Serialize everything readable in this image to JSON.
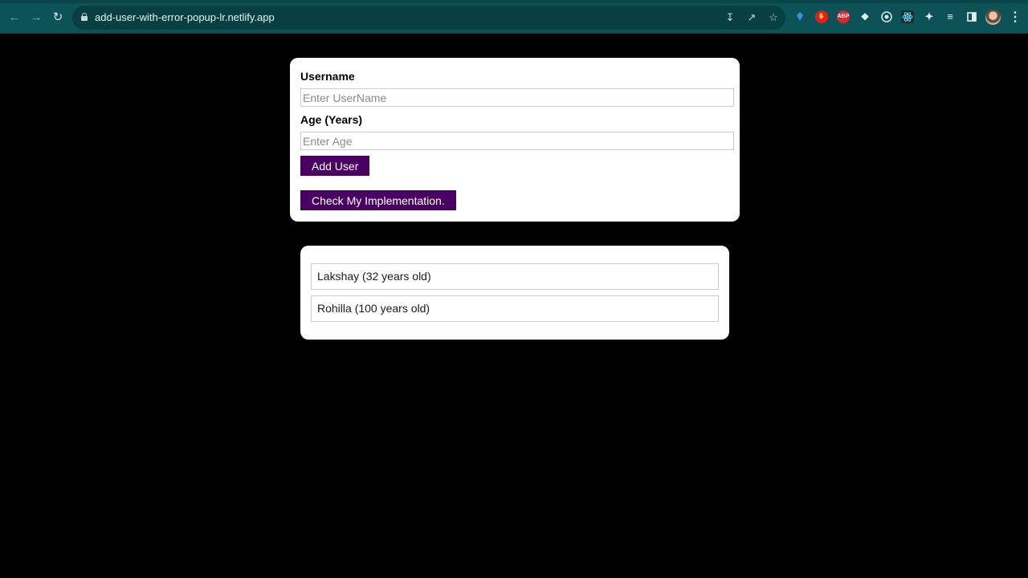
{
  "browser": {
    "url": "add-user-with-error-popup-lr.netlify.app",
    "icons": {
      "back": "arrow-left-icon",
      "forward": "arrow-right-icon",
      "reload": "reload-icon",
      "install": "install-icon",
      "share": "share-icon",
      "bookmark": "star-icon",
      "extensions": "puzzle-icon",
      "reading_list": "reading-list-icon",
      "side_panel": "side-panel-icon",
      "menu": "more-vert-icon"
    },
    "extensions": [
      {
        "name": "diamond-extension-icon",
        "color": "#3d8fe0",
        "text": ""
      },
      {
        "name": "hand-extension-icon",
        "color": "#e02020",
        "text": ""
      },
      {
        "name": "adblock-extension-icon",
        "color": "#d8282f",
        "text": "ABP"
      },
      {
        "name": "move-extension-icon",
        "color": "#0d5257",
        "text": ""
      },
      {
        "name": "target-extension-icon",
        "color": "#0d5257",
        "text": ""
      },
      {
        "name": "react-extension-icon",
        "color": "#0d5257",
        "text": ""
      }
    ],
    "colors": {
      "chrome": "#0d5257",
      "omnibox": "#083f43"
    }
  },
  "form": {
    "username_label": "Username",
    "username_placeholder": "Enter UserName",
    "username_value": "",
    "age_label": "Age (Years)",
    "age_placeholder": "Enter Age",
    "age_value": "",
    "add_button_label": "Add User",
    "check_button_label": "Check My Implementation.",
    "button_color": "#4a0262"
  },
  "users": [
    {
      "text": "Lakshay (32 years old)"
    },
    {
      "text": "Rohilla (100 years old)"
    }
  ]
}
